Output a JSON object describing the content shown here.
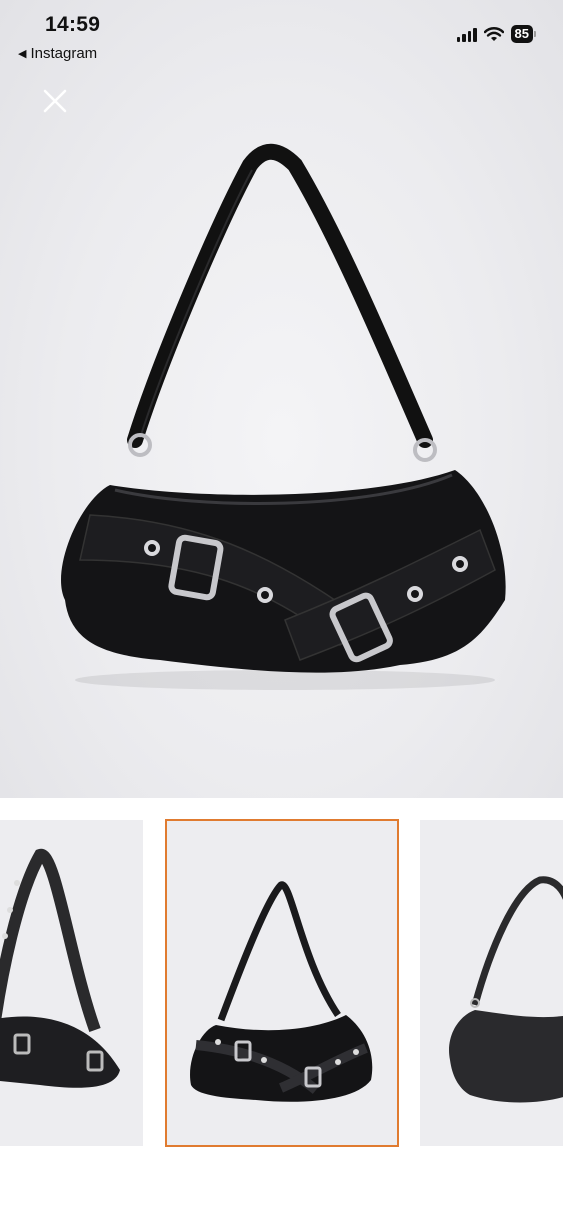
{
  "status_bar": {
    "time": "14:59",
    "back_app": "Instagram",
    "battery": "85",
    "icons": [
      "back-triangle-icon",
      "signal-icon",
      "wifi-icon",
      "battery-icon"
    ]
  },
  "viewer": {
    "close_icon": "close-icon",
    "main_image": "black-buckle-shoulder-bag",
    "background": "#ebebee"
  },
  "thumbnails": [
    {
      "name": "thumb-side-view",
      "selected": false
    },
    {
      "name": "thumb-front-view",
      "selected": true
    },
    {
      "name": "thumb-back-view",
      "selected": false
    }
  ],
  "colors": {
    "selection_outline": "#e07b30",
    "bag": "#141416",
    "hardware": "#c8c8cc"
  }
}
